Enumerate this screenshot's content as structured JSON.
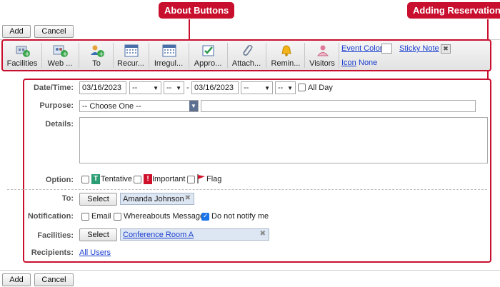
{
  "callouts": {
    "about_buttons": "About Buttons",
    "adding_reservation": "Adding Reservation"
  },
  "top_actions": {
    "add": "Add",
    "cancel": "Cancel"
  },
  "bottom_actions": {
    "add": "Add",
    "cancel": "Cancel"
  },
  "toolbar": {
    "buttons": [
      {
        "label": "Facilities",
        "icon": "facilities-icon"
      },
      {
        "label": "Web ...",
        "icon": "web-meeting-icon"
      },
      {
        "label": "To",
        "icon": "add-user-icon"
      },
      {
        "label": "Recur...",
        "icon": "calendar-icon"
      },
      {
        "label": "Irregul...",
        "icon": "calendar-icon"
      },
      {
        "label": "Appro...",
        "icon": "approval-icon"
      },
      {
        "label": "Attach...",
        "icon": "paperclip-icon"
      },
      {
        "label": "Remin...",
        "icon": "bell-icon"
      },
      {
        "label": "Visitors",
        "icon": "visitor-icon"
      }
    ],
    "event_color": "Event Color",
    "sticky_note": "Sticky Note",
    "icon_link": "Icon",
    "icon_value": "None"
  },
  "form": {
    "datetime": {
      "label": "Date/Time:",
      "start_date": "03/16/2023",
      "start_hour": "--",
      "start_min": "--",
      "dash": "-",
      "end_date": "03/16/2023",
      "end_hour": "--",
      "end_min": "--",
      "all_day": "All Day"
    },
    "purpose": {
      "label": "Purpose:",
      "value": "-- Choose One --"
    },
    "details": {
      "label": "Details:"
    },
    "option": {
      "label": "Option:",
      "tentative": "Tentative",
      "tentative_badge": "T",
      "important": "Important",
      "important_badge": "!",
      "flag": "Flag"
    },
    "to": {
      "label": "To:",
      "select": "Select",
      "user": "Amanda Johnson"
    },
    "notification": {
      "label": "Notification:",
      "email": "Email",
      "whereabouts": "Whereabouts Message",
      "do_not_notify": "Do not notify me",
      "do_not_notify_checked": true
    },
    "facilities": {
      "label": "Facilities:",
      "select": "Select",
      "room": "Conference Room A"
    },
    "recipients": {
      "label": "Recipients:",
      "value": "All Users"
    }
  },
  "colors": {
    "callout": "#c8102e",
    "link": "#1a3ecf",
    "tentative": "#2a9d75",
    "important": "#d0112b"
  }
}
